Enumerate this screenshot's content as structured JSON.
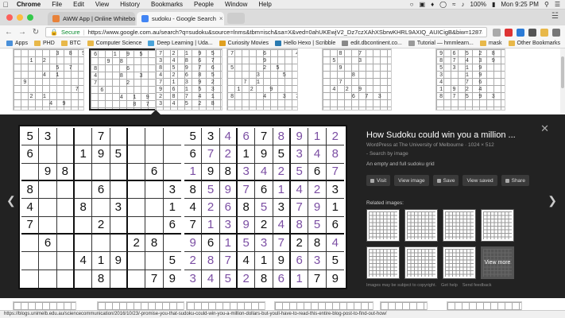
{
  "menubar": {
    "apple_icon": "apple-icon",
    "app_name": "Chrome",
    "items": [
      "File",
      "Edit",
      "View",
      "History",
      "Bookmarks",
      "People",
      "Window",
      "Help"
    ],
    "battery": "100%",
    "clock": "Mon 9:25 PM"
  },
  "tabs": [
    {
      "label": "AWW App | Online Whiteboard",
      "active": false,
      "color": "#e8823a"
    },
    {
      "label": "sudoku - Google Search",
      "active": true,
      "color": "#4285f4"
    }
  ],
  "toolbar": {
    "secure_label": "Secure",
    "url": "https://www.google.com.au/search?q=sudoku&source=lnms&tbm=isch&sa=X&ved=0ahUKEwjV2_Dz7czXAhXSbrwKHRL9AXIQ_AUICigB&biw=1287&bih=84..."
  },
  "bookmarks": [
    {
      "label": "Apps",
      "color": "#4a90d9"
    },
    {
      "label": "PHD",
      "color": "#e8b84a"
    },
    {
      "label": "BTC",
      "color": "#e8b84a"
    },
    {
      "label": "Computer Science",
      "color": "#e8b84a"
    },
    {
      "label": "Deep Learning | Uda...",
      "color": "#4aa3d9"
    },
    {
      "label": "Curiosity Movies",
      "color": "#e0a020"
    },
    {
      "label": "Hello Hexo | Scribble",
      "color": "#2a7ab0"
    },
    {
      "label": "edit.dbcontinent.co...",
      "color": "#888888"
    },
    {
      "label": "Tutorial — hmmlearn...",
      "color": "#999999"
    },
    {
      "label": "mask",
      "color": "#e8b84a"
    }
  ],
  "other_bookmarks": "Other Bookmarks",
  "result_thumbs": [
    {
      "nums": "      3 8 5\n  1 2\n      5 7\n    4 1\n 9\n         7 3\n  2 1\n     4 9"
    },
    {
      "nums": "6  1 9 5\n  9 8\n8    6\n4   8  3\n7    2\n 6\n    4 1 9\n      8 7"
    },
    {
      "nums": "7 2 1 9 5 3\n3 4 8 6 7 9\n8 5 9 7 6 1\n4 2 6 8 5 3\n7 1 3 9 2 4\n9 6 1 5 3 7\n2 8 7 4 1 9\n3 4 5 2 8 6"
    },
    {
      "nums": "7    6    4\n     9\n5    2 5\n    3   5\n  7 1\n 1 2  9\n8    4  3 7"
    },
    {
      "nums": "  8  7\n 5   3\n  9\n    8\n  7\n 4 2 9\n    6 7 3 2 1"
    },
    {
      "nums": "9 6 5 2 8\n8 7 4 3 9\n5 3 1 9\n3   1 9\n4   7 6\n1 9 2 4\n8 7 5 9 3 4"
    }
  ],
  "viewer": {
    "title": "How Sudoku could win you a million ...",
    "source": "WordPress at The University of Melbourne · 1024 × 512",
    "search_by_image": "- Search by image",
    "description": "An empty and full sudoku grid",
    "buttons": [
      {
        "label": "Visit",
        "icon": "open-icon"
      },
      {
        "label": "View image",
        "icon": "image-icon"
      },
      {
        "label": "Save",
        "icon": "save-icon"
      },
      {
        "label": "View saved",
        "icon": "saved-icon"
      },
      {
        "label": "Share",
        "icon": "share-icon"
      }
    ],
    "related_label": "Related images:",
    "view_more": "View more",
    "footer_copyright": "Images may be subject to copyright.",
    "footer_help": "Get help",
    "footer_feedback": "Send feedback",
    "left_puzzle": [
      [
        5,
        3,
        0,
        0,
        7,
        0,
        0,
        0,
        0
      ],
      [
        6,
        0,
        0,
        1,
        9,
        5,
        0,
        0,
        0
      ],
      [
        0,
        9,
        8,
        0,
        0,
        0,
        0,
        6,
        0
      ],
      [
        8,
        0,
        0,
        0,
        6,
        0,
        0,
        0,
        3
      ],
      [
        4,
        0,
        0,
        8,
        0,
        3,
        0,
        0,
        1
      ],
      [
        7,
        0,
        0,
        0,
        2,
        0,
        0,
        0,
        6
      ],
      [
        0,
        6,
        0,
        0,
        0,
        0,
        2,
        8,
        0
      ],
      [
        0,
        0,
        0,
        4,
        1,
        9,
        0,
        0,
        5
      ],
      [
        0,
        0,
        0,
        0,
        8,
        0,
        0,
        7,
        9
      ]
    ],
    "right_solution": [
      [
        5,
        3,
        4,
        6,
        7,
        8,
        9,
        1,
        2
      ],
      [
        6,
        7,
        2,
        1,
        9,
        5,
        3,
        4,
        8
      ],
      [
        1,
        9,
        8,
        3,
        4,
        2,
        5,
        6,
        7
      ],
      [
        8,
        5,
        9,
        7,
        6,
        1,
        4,
        2,
        3
      ],
      [
        4,
        2,
        6,
        8,
        5,
        3,
        7,
        9,
        1
      ],
      [
        7,
        1,
        3,
        9,
        2,
        4,
        8,
        5,
        6
      ],
      [
        9,
        6,
        1,
        5,
        3,
        7,
        2,
        8,
        4
      ],
      [
        2,
        8,
        7,
        4,
        1,
        9,
        6,
        3,
        5
      ],
      [
        3,
        4,
        5,
        2,
        8,
        6,
        1,
        7,
        9
      ]
    ],
    "given_color": "#111111",
    "solved_color": "#7b4ea3"
  },
  "status_url": "https://blogs.unimelb.edu.au/sciencecommunication/2016/10/23/-promise-you-that-sudoku-could-win-you-a-million-dollars-but-youll-have-to-read-this-entire-blog-post-to-find-out-how/"
}
